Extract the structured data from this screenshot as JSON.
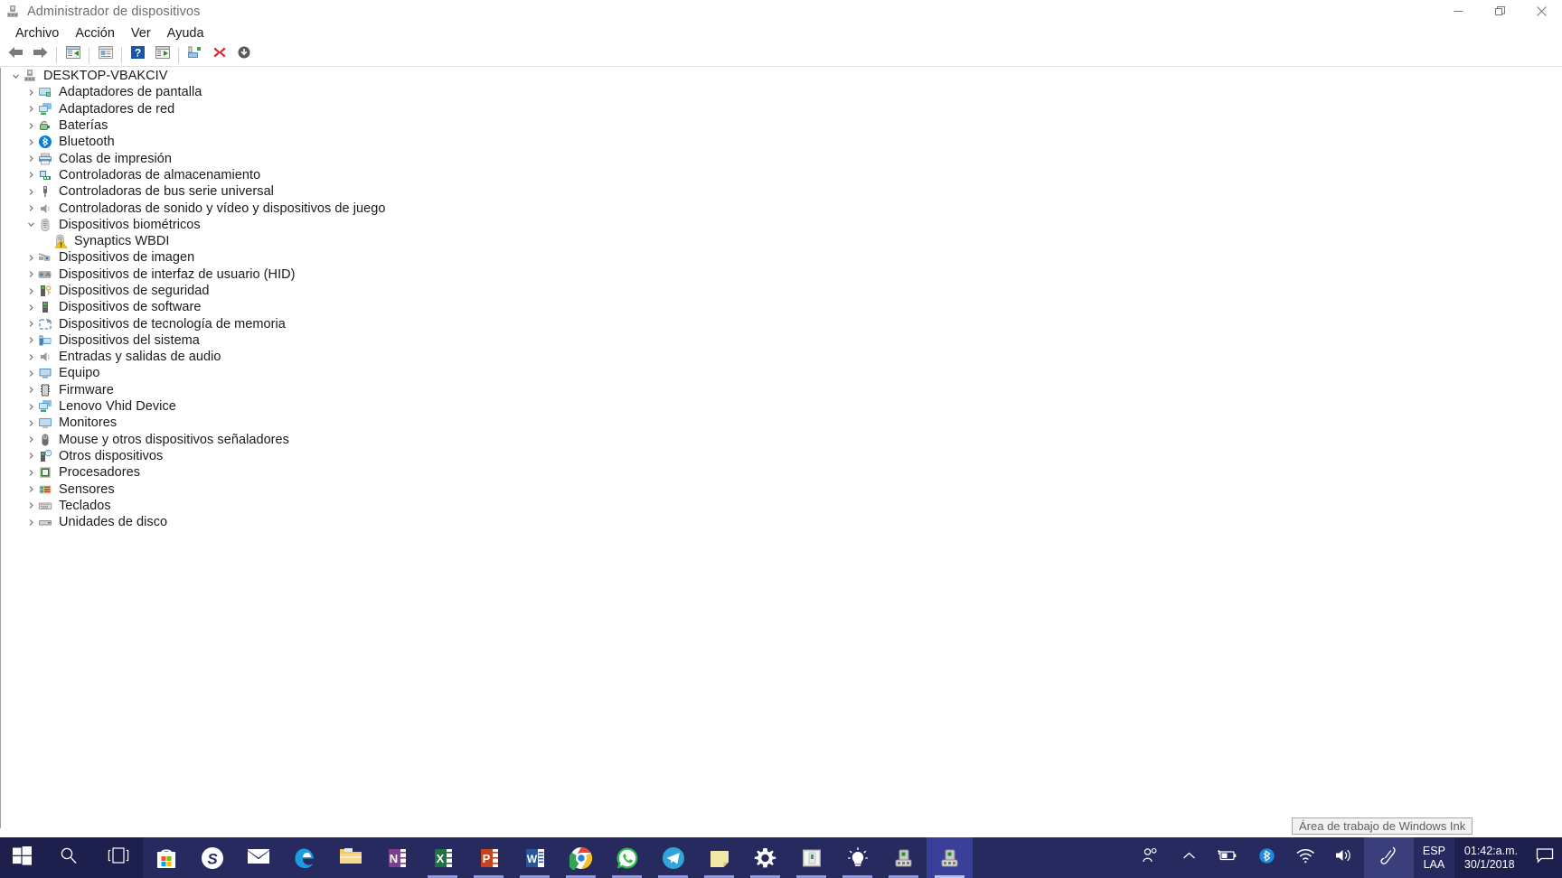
{
  "window": {
    "title": "Administrador de dispositivos",
    "title_icon": "device-manager-icon",
    "controls": {
      "minimize": "Minimizar",
      "restore": "Restaurar",
      "close": "Cerrar"
    }
  },
  "menu": {
    "items": [
      {
        "label": "Archivo",
        "name": "menu-archivo"
      },
      {
        "label": "Acción",
        "name": "menu-accion"
      },
      {
        "label": "Ver",
        "name": "menu-ver"
      },
      {
        "label": "Ayuda",
        "name": "menu-ayuda"
      }
    ]
  },
  "toolbar": {
    "buttons": [
      {
        "name": "back-button",
        "icon": "arrow-left-icon",
        "tooltip": "Atrás"
      },
      {
        "name": "forward-button",
        "icon": "arrow-right-icon",
        "tooltip": "Adelante"
      },
      {
        "name": "show-hide-console-tree-button",
        "icon": "console-tree-icon",
        "tooltip": "Mostrar u ocultar árbol de consola"
      },
      {
        "name": "properties-button",
        "icon": "properties-icon",
        "tooltip": "Propiedades"
      },
      {
        "name": "help-button",
        "icon": "help-question-icon",
        "tooltip": "Ayuda"
      },
      {
        "name": "scan-hardware-changes-button",
        "icon": "scan-hardware-icon",
        "tooltip": "Buscar cambios de hardware"
      },
      {
        "name": "update-driver-button",
        "icon": "update-driver-icon",
        "tooltip": "Actualizar controlador"
      },
      {
        "name": "uninstall-device-button",
        "icon": "red-x-icon",
        "tooltip": "Desinstalar dispositivo"
      },
      {
        "name": "disable-device-button",
        "icon": "disable-device-icon",
        "tooltip": "Deshabilitar dispositivo"
      }
    ]
  },
  "tree": {
    "root": {
      "label": "DESKTOP-VBAKCIV",
      "icon": "computer-icon",
      "expanded": true
    },
    "nodes": [
      {
        "label": "Adaptadores de pantalla",
        "icon": "display-adapter-icon",
        "level": 1,
        "expanded": false
      },
      {
        "label": "Adaptadores de red",
        "icon": "network-adapter-icon",
        "level": 1,
        "expanded": false
      },
      {
        "label": "Baterías",
        "icon": "battery-icon",
        "level": 1,
        "expanded": false
      },
      {
        "label": "Bluetooth",
        "icon": "bluetooth-icon",
        "level": 1,
        "expanded": false
      },
      {
        "label": "Colas de impresión",
        "icon": "printer-icon",
        "level": 1,
        "expanded": false
      },
      {
        "label": "Controladoras de almacenamiento",
        "icon": "storage-controller-icon",
        "level": 1,
        "expanded": false
      },
      {
        "label": "Controladoras de bus serie universal",
        "icon": "usb-controller-icon",
        "level": 1,
        "expanded": false
      },
      {
        "label": "Controladoras de sonido y vídeo y dispositivos de juego",
        "icon": "sound-video-icon",
        "level": 1,
        "expanded": false
      },
      {
        "label": "Dispositivos biométricos",
        "icon": "biometric-icon",
        "level": 1,
        "expanded": true
      },
      {
        "label": "Synaptics WBDI",
        "icon": "biometric-warning-icon",
        "level": 2,
        "expanded": null,
        "warning": true
      },
      {
        "label": "Dispositivos de imagen",
        "icon": "imaging-device-icon",
        "level": 1,
        "expanded": false
      },
      {
        "label": "Dispositivos de interfaz de usuario (HID)",
        "icon": "hid-device-icon",
        "level": 1,
        "expanded": false
      },
      {
        "label": "Dispositivos de seguridad",
        "icon": "security-device-icon",
        "level": 1,
        "expanded": false
      },
      {
        "label": "Dispositivos de software",
        "icon": "software-device-icon",
        "level": 1,
        "expanded": false
      },
      {
        "label": "Dispositivos de tecnología de memoria",
        "icon": "memory-technology-icon",
        "level": 1,
        "expanded": false
      },
      {
        "label": "Dispositivos del sistema",
        "icon": "system-device-icon",
        "level": 1,
        "expanded": false
      },
      {
        "label": "Entradas y salidas de audio",
        "icon": "audio-io-icon",
        "level": 1,
        "expanded": false
      },
      {
        "label": "Equipo",
        "icon": "computer-device-icon",
        "level": 1,
        "expanded": false
      },
      {
        "label": "Firmware",
        "icon": "firmware-icon",
        "level": 1,
        "expanded": false
      },
      {
        "label": "Lenovo Vhid Device",
        "icon": "vhid-device-icon",
        "level": 1,
        "expanded": false
      },
      {
        "label": "Monitores",
        "icon": "monitor-icon",
        "level": 1,
        "expanded": false
      },
      {
        "label": "Mouse y otros dispositivos señaladores",
        "icon": "mouse-icon",
        "level": 1,
        "expanded": false
      },
      {
        "label": "Otros dispositivos",
        "icon": "other-device-icon",
        "level": 1,
        "expanded": false
      },
      {
        "label": "Procesadores",
        "icon": "processor-icon",
        "level": 1,
        "expanded": false
      },
      {
        "label": "Sensores",
        "icon": "sensor-icon",
        "level": 1,
        "expanded": false
      },
      {
        "label": "Teclados",
        "icon": "keyboard-icon",
        "level": 1,
        "expanded": false
      },
      {
        "label": "Unidades de disco",
        "icon": "disk-drive-icon",
        "level": 1,
        "expanded": false
      }
    ]
  },
  "tooltip": {
    "text": "Área de trabajo de Windows Ink"
  },
  "taskbar": {
    "start": {
      "name": "start-button",
      "icon": "windows-logo-icon"
    },
    "search": {
      "name": "search-button",
      "icon": "search-icon"
    },
    "taskview": {
      "name": "task-view-button",
      "icon": "task-view-icon"
    },
    "apps": [
      {
        "name": "taskbar-microsoft-store",
        "icon": "microsoft-store-icon",
        "running": false,
        "active": false
      },
      {
        "name": "taskbar-skype",
        "icon": "skype-icon",
        "running": false,
        "active": false
      },
      {
        "name": "taskbar-mail",
        "icon": "mail-icon",
        "running": false,
        "active": false
      },
      {
        "name": "taskbar-edge",
        "icon": "edge-icon",
        "running": false,
        "active": false
      },
      {
        "name": "taskbar-file-explorer",
        "icon": "file-explorer-icon",
        "running": false,
        "active": false
      },
      {
        "name": "taskbar-onenote",
        "icon": "onenote-icon",
        "running": false,
        "active": false
      },
      {
        "name": "taskbar-excel",
        "icon": "excel-icon",
        "running": true,
        "active": false
      },
      {
        "name": "taskbar-powerpoint",
        "icon": "powerpoint-icon",
        "running": true,
        "active": false
      },
      {
        "name": "taskbar-word",
        "icon": "word-icon",
        "running": true,
        "active": false
      },
      {
        "name": "taskbar-chrome",
        "icon": "chrome-icon",
        "running": true,
        "active": false
      },
      {
        "name": "taskbar-whatsapp",
        "icon": "whatsapp-icon",
        "running": true,
        "active": false
      },
      {
        "name": "taskbar-telegram",
        "icon": "telegram-icon",
        "running": true,
        "active": false
      },
      {
        "name": "taskbar-sticky-notes",
        "icon": "sticky-notes-icon",
        "running": true,
        "active": false
      },
      {
        "name": "taskbar-settings",
        "icon": "settings-gear-icon",
        "running": true,
        "active": false
      },
      {
        "name": "taskbar-explorer-window",
        "icon": "folder-window-icon",
        "running": true,
        "active": false
      },
      {
        "name": "taskbar-idea-lightbulb",
        "icon": "lightbulb-icon",
        "running": true,
        "active": false
      },
      {
        "name": "taskbar-device-manager-1",
        "icon": "device-manager-icon",
        "running": true,
        "active": false
      },
      {
        "name": "taskbar-device-manager-2",
        "icon": "device-manager-icon",
        "running": true,
        "active": true
      }
    ],
    "tray": [
      {
        "name": "tray-people-icon",
        "icon": "people-icon"
      },
      {
        "name": "tray-show-hidden-icons",
        "icon": "chevron-up-icon"
      },
      {
        "name": "tray-battery",
        "icon": "battery-charging-icon"
      },
      {
        "name": "tray-bluetooth",
        "icon": "bluetooth-icon"
      },
      {
        "name": "tray-network",
        "icon": "wifi-icon"
      },
      {
        "name": "tray-volume",
        "icon": "speaker-icon"
      },
      {
        "name": "tray-windows-ink",
        "icon": "pen-icon"
      }
    ],
    "language": {
      "line1": "ESP",
      "line2": "LAA"
    },
    "clock": {
      "time": "01:42:a.m.",
      "date": "30/1/2018"
    },
    "action_center": {
      "name": "action-center-button",
      "icon": "notification-icon"
    }
  },
  "colors": {
    "taskbar_bg": "#272a5e",
    "taskbar_dark": "#1d1f4d",
    "taskbar_active": "#3a4099",
    "window_bg": "#ffffff",
    "text": "#1b1b1b",
    "title_text": "#6e6e6e",
    "accent_blue": "#0078d7",
    "warning_yellow": "#f0c419",
    "error_red": "#d93025"
  }
}
